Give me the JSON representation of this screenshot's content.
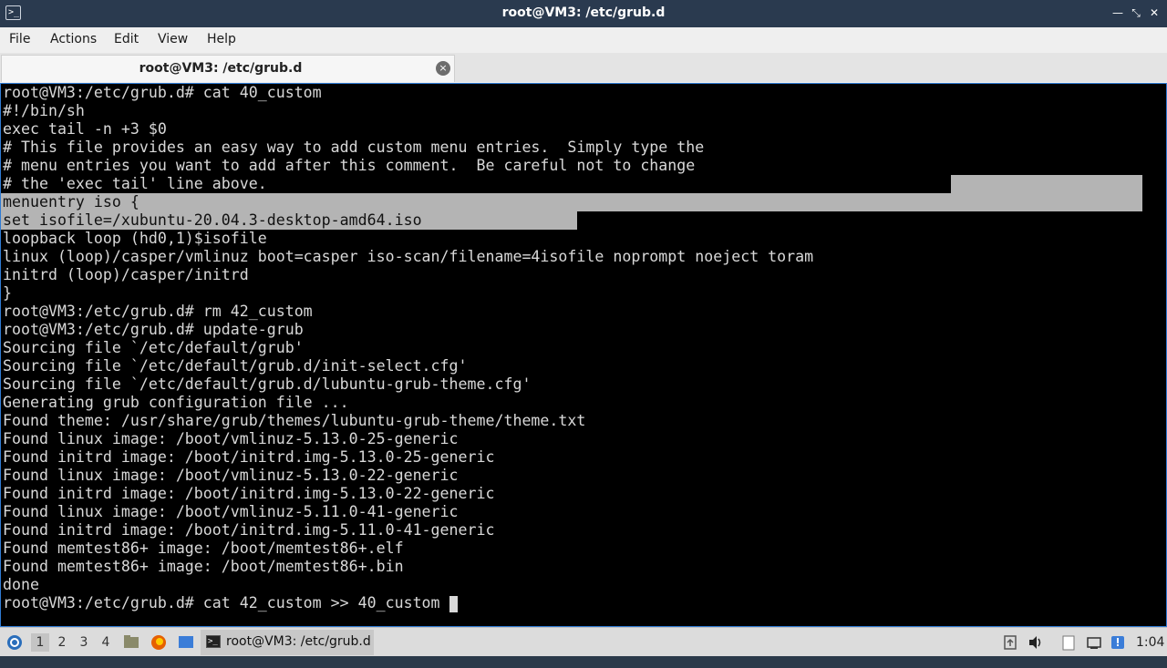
{
  "window": {
    "title": "root@VM3: /etc/grub.d"
  },
  "menu": [
    "File",
    "Actions",
    "Edit",
    "View",
    "Help"
  ],
  "tab": {
    "label": "root@VM3: /etc/grub.d",
    "close_symbol": "×"
  },
  "terminal": {
    "lines": [
      "root@VM3:/etc/grub.d# cat 40_custom",
      "#!/bin/sh",
      "exec tail -n +3 $0",
      "# This file provides an easy way to add custom menu entries.  Simply type the",
      "# menu entries you want to add after this comment.  Be careful not to change",
      "# the 'exec tail' line above.",
      "menuentry iso {",
      "set isofile=/xubuntu-20.04.3-desktop-amd64.iso",
      "loopback loop (hd0,1)$isofile",
      "linux (loop)/casper/vmlinuz boot=casper iso-scan/filename=4isofile noprompt noeject toram",
      "initrd (loop)/casper/initrd",
      "}",
      "root@VM3:/etc/grub.d# rm 42_custom",
      "root@VM3:/etc/grub.d# update-grub",
      "Sourcing file `/etc/default/grub'",
      "Sourcing file `/etc/default/grub.d/init-select.cfg'",
      "Sourcing file `/etc/default/grub.d/lubuntu-grub-theme.cfg'",
      "Generating grub configuration file ...",
      "Found theme: /usr/share/grub/themes/lubuntu-grub-theme/theme.txt",
      "Found linux image: /boot/vmlinuz-5.13.0-25-generic",
      "Found initrd image: /boot/initrd.img-5.13.0-25-generic",
      "Found linux image: /boot/vmlinuz-5.13.0-22-generic",
      "Found initrd image: /boot/initrd.img-5.13.0-22-generic",
      "Found linux image: /boot/vmlinuz-5.11.0-41-generic",
      "Found initrd image: /boot/initrd.img-5.11.0-41-generic",
      "Found memtest86+ image: /boot/memtest86+.elf",
      "Found memtest86+ image: /boot/memtest86+.bin",
      "done",
      "root@VM3:/etc/grub.d# cat 42_custom >> 40_custom "
    ]
  },
  "taskbar": {
    "workspaces": [
      "1",
      "2",
      "3",
      "4"
    ],
    "active_workspace": "1",
    "task_label": "root@VM3: /etc/grub.d",
    "clock": "1:04"
  },
  "colors": {
    "titlebar": "#2a3a4f",
    "terminal_bg": "#000000",
    "terminal_fg": "#d8d8d8",
    "selection": "#b4b4b4",
    "focus_border": "#2f7bd3"
  }
}
